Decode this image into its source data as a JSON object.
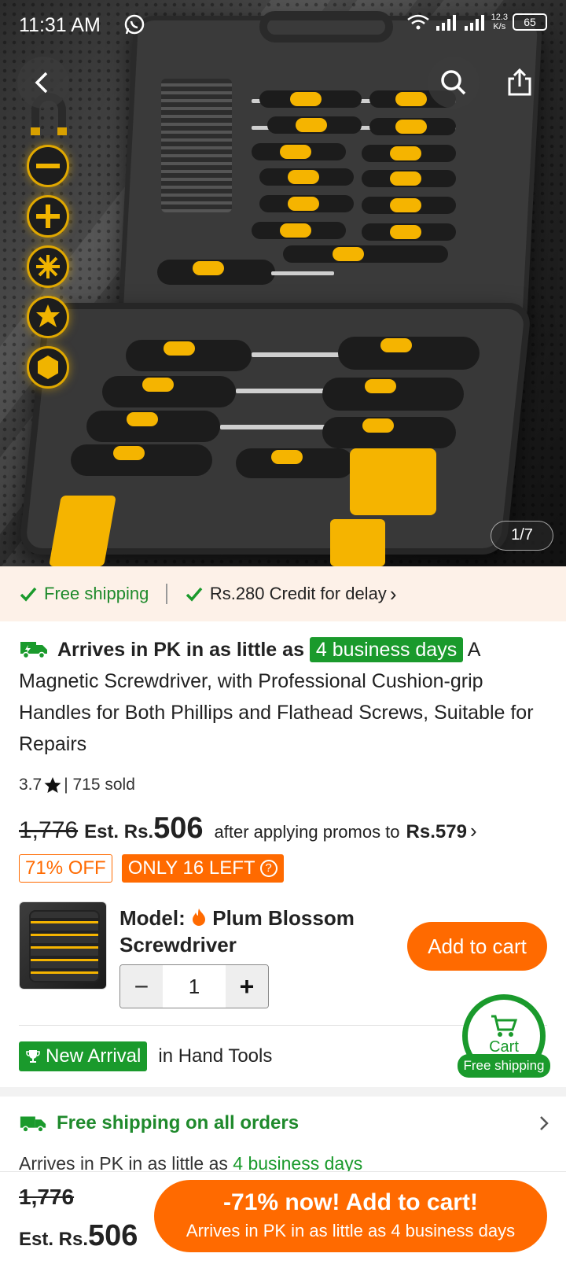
{
  "status_bar": {
    "time": "11:31 AM",
    "network_speed_value": "12.3",
    "network_speed_unit": "K/s",
    "battery": "65"
  },
  "gallery": {
    "counter": "1/7"
  },
  "shipping_bar": {
    "free_shipping": "Free shipping",
    "credit": "Rs.280 Credit for delay",
    "chevron": "›"
  },
  "product": {
    "arrive_prefix": "Arrives in PK in as little as",
    "arrive_days": "4 business days",
    "title": "A Magnetic Screwdriver, with Professional Cushion-grip Handles for Both Phillips and Flathead Screws, Suitable for Repairs",
    "rating": "3.7",
    "sold": "| 715 sold",
    "old_price": "1,776",
    "est_label": "Est. Rs.",
    "price": "506",
    "promo_text": "after applying promos to",
    "promo_price": "Rs.579",
    "promo_chevron": "›",
    "discount_badge": "71% OFF",
    "stock_badge": "ONLY 16 LEFT",
    "help_icon_glyph": "?"
  },
  "variant": {
    "model_label": "Model:",
    "model_value": "Plum Blossom Screwdriver",
    "quantity": "1",
    "minus": "−",
    "plus": "+",
    "add_to_cart": "Add to cart"
  },
  "category": {
    "tag": "New Arrival",
    "text": "in Hand Tools"
  },
  "floating_cart": {
    "label": "Cart",
    "sub": "Free shipping"
  },
  "delivery": {
    "free_all": "Free shipping on all orders",
    "arrive_prefix": "Arrives in PK in as little as",
    "arrive_days": "4 business days"
  },
  "bottom_bar": {
    "old_price": "1,776",
    "est_label": "Est. Rs.",
    "price": "506",
    "cta_line1": "-71% now! Add to cart!",
    "cta_line2": "Arrives in PK in as little as 4 business days"
  },
  "icons": {
    "back": "back-arrow-icon",
    "search": "search-icon",
    "share": "share-icon",
    "check": "check-icon",
    "truck": "truck-icon",
    "star": "star-icon",
    "flame": "flame-icon",
    "trophy": "trophy-icon",
    "cart": "cart-icon",
    "chevron": "chevron-right-icon"
  },
  "colors": {
    "accent_orange": "#ff6a00",
    "accent_green": "#1a9a2c",
    "shipping_bar_bg": "#fdf1e8"
  }
}
